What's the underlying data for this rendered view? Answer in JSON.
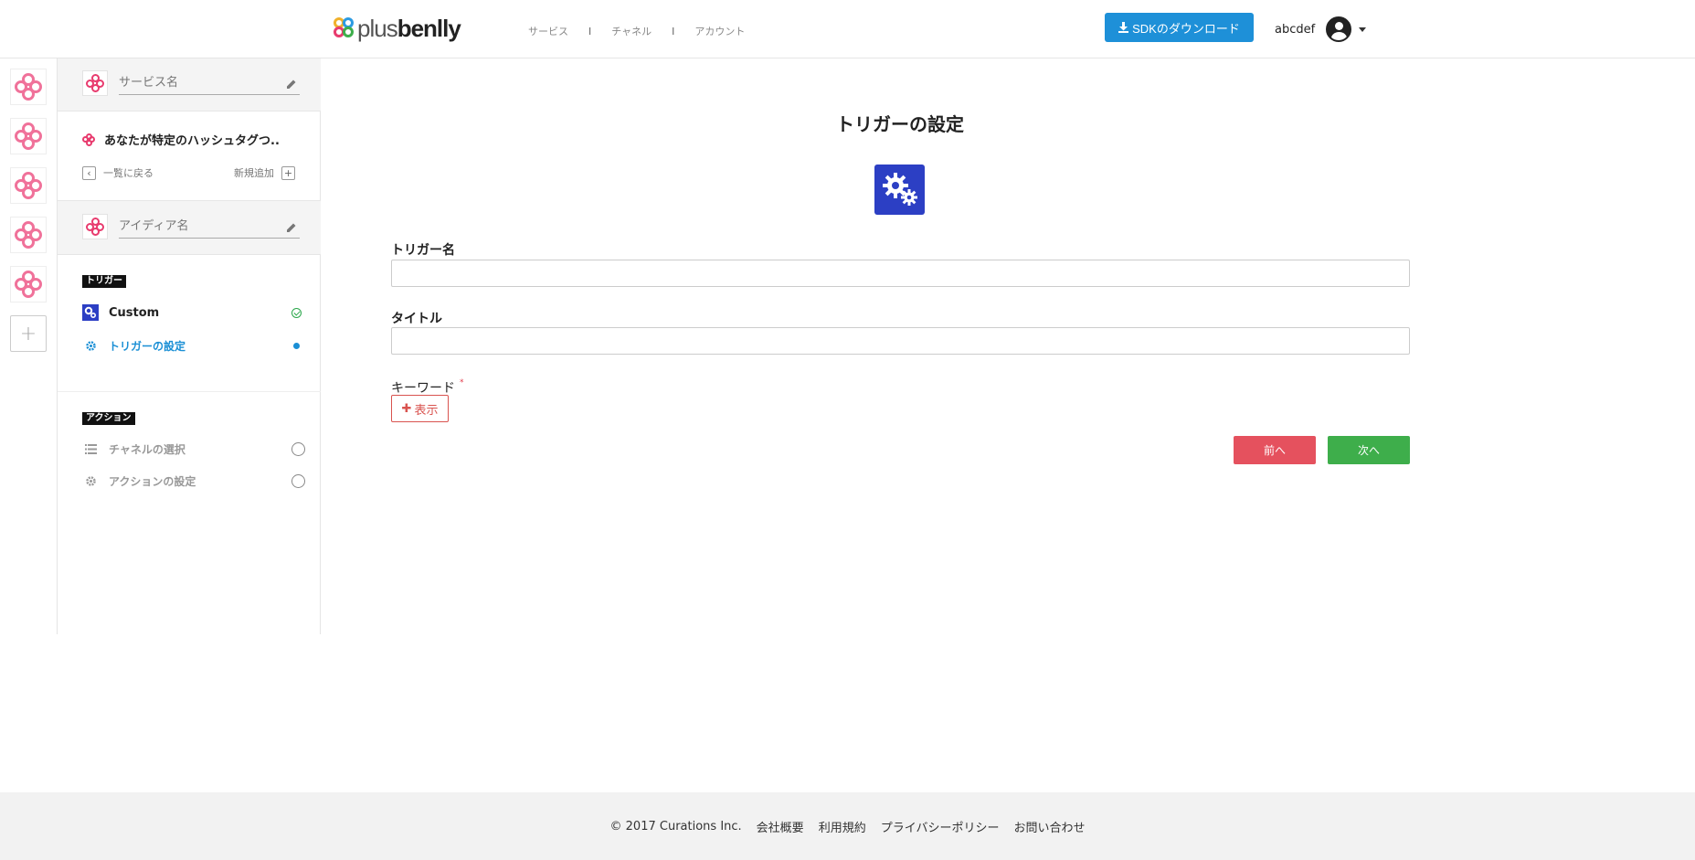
{
  "header": {
    "logo_plain": "plus",
    "logo_bold": "benlly",
    "nav": [
      "サービス",
      "チャネル",
      "アカウント"
    ],
    "separator": "I",
    "sdk_button": "SDKのダウンロード",
    "username": "abcdef"
  },
  "sidebar": {
    "service_name_placeholder": "サービス名",
    "service_title": "あなたが特定のハッシュタグつ..",
    "back_label": "一覧に戻る",
    "new_label": "新規追加",
    "idea_name_placeholder": "アイディア名",
    "trigger_section": "トリガー",
    "trigger_items": [
      {
        "label": "Custom",
        "status": "done"
      },
      {
        "label": "トリガーの設定",
        "status": "active"
      }
    ],
    "action_section": "アクション",
    "action_items": [
      {
        "label": "チャネルの選択",
        "status": "pending"
      },
      {
        "label": "アクションの設定",
        "status": "pending"
      }
    ]
  },
  "main": {
    "title": "トリガーの設定",
    "trigger_name_label": "トリガー名",
    "trigger_name_value": "",
    "title_label": "タイトル",
    "title_value": "",
    "keyword_label": "キーワード",
    "required_mark": "*",
    "show_button": "表示",
    "prev_button": "前へ",
    "next_button": "次へ"
  },
  "footer": {
    "copyright": "© 2017 Curations Inc.",
    "links": [
      "会社概要",
      "利用規約",
      "プライバシーポリシー",
      "お問い合わせ"
    ]
  },
  "colors": {
    "primary_blue": "#1e90d8",
    "trigger_blue": "#2c3fc4",
    "danger": "#e5515e",
    "success": "#3eae4b",
    "service_pink": "#e83b6e"
  }
}
